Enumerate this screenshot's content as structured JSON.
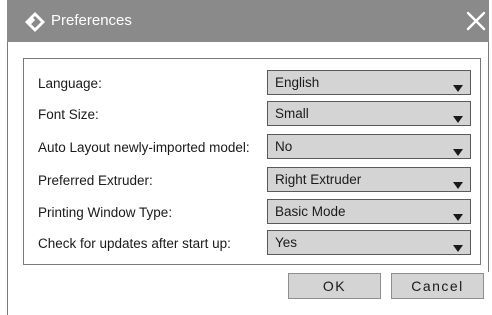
{
  "window": {
    "title": "Preferences",
    "icons": {
      "logo": "app-logo-icon",
      "close": "close-icon"
    }
  },
  "settings": [
    {
      "key": "language",
      "label": "Language:",
      "value": "English"
    },
    {
      "key": "font_size",
      "label": "Font Size:",
      "value": "Small"
    },
    {
      "key": "auto_layout",
      "label": "Auto Layout newly-imported model:",
      "value": "No"
    },
    {
      "key": "preferred_extruder",
      "label": "Preferred Extruder:",
      "value": "Right Extruder"
    },
    {
      "key": "printing_window_type",
      "label": "Printing Window Type:",
      "value": "Basic Mode"
    },
    {
      "key": "check_updates",
      "label": "Check for updates after start up:",
      "value": "Yes"
    }
  ],
  "buttons": {
    "ok": "OK",
    "cancel": "Cancel"
  },
  "colors": {
    "titlebar": "#8a8a8a",
    "control": "#d4d4d4",
    "border": "#7a7a7a"
  }
}
